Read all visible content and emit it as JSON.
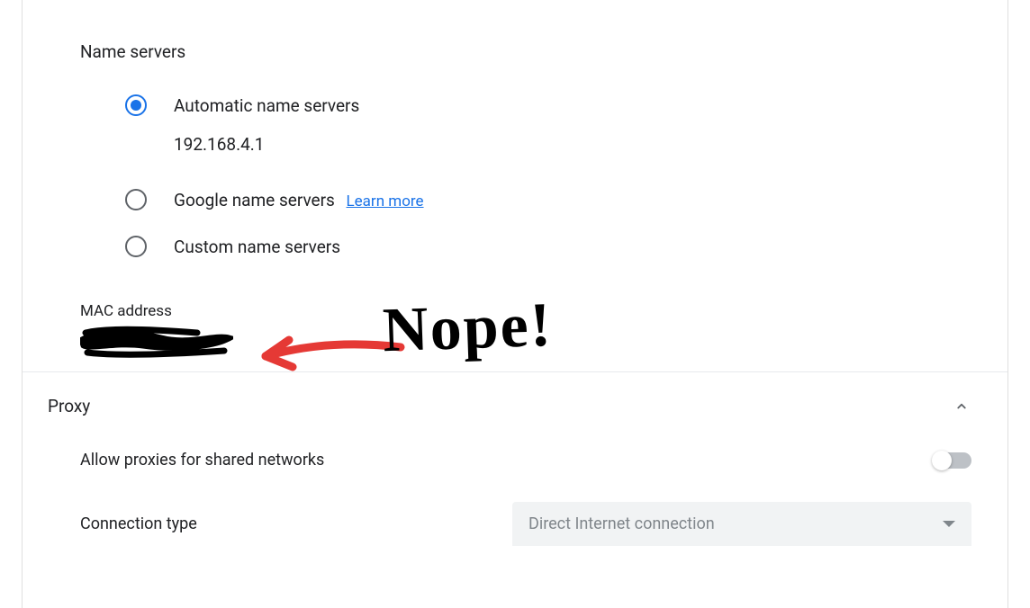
{
  "nameservers": {
    "title": "Name servers",
    "auto_label": "Automatic name servers",
    "auto_value": "192.168.4.1",
    "google_label": "Google name servers",
    "learn_more": "Learn more",
    "custom_label": "Custom name servers",
    "selected": "auto"
  },
  "mac": {
    "label": "MAC address"
  },
  "proxy": {
    "title": "Proxy",
    "allow_label": "Allow proxies for shared networks",
    "allow_enabled": false,
    "conn_type_label": "Connection type",
    "conn_type_value": "Direct Internet connection",
    "expanded": true
  },
  "annotation": {
    "text": "Nope!"
  }
}
